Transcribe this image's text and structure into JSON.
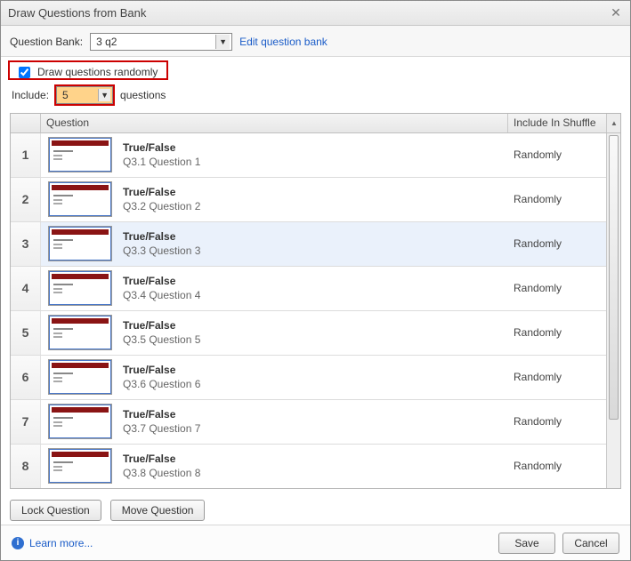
{
  "title": "Draw Questions from Bank",
  "bank": {
    "label": "Question Bank:",
    "selected": "3 q2",
    "edit_link": "Edit question bank"
  },
  "random": {
    "checked": true,
    "label": "Draw questions randomly"
  },
  "include": {
    "label": "Include:",
    "value": "5",
    "suffix": "questions"
  },
  "columns": {
    "question": "Question",
    "include": "Include In Shuffle"
  },
  "include_value": "Randomly",
  "rows": [
    {
      "n": "1",
      "type": "True/False",
      "title": "Q3.1 Question 1",
      "selected": false
    },
    {
      "n": "2",
      "type": "True/False",
      "title": "Q3.2 Question 2",
      "selected": false
    },
    {
      "n": "3",
      "type": "True/False",
      "title": "Q3.3 Question 3",
      "selected": true
    },
    {
      "n": "4",
      "type": "True/False",
      "title": "Q3.4 Question 4",
      "selected": false
    },
    {
      "n": "5",
      "type": "True/False",
      "title": "Q3.5 Question 5",
      "selected": false
    },
    {
      "n": "6",
      "type": "True/False",
      "title": "Q3.6 Question 6",
      "selected": false
    },
    {
      "n": "7",
      "type": "True/False",
      "title": "Q3.7 Question 7",
      "selected": false
    },
    {
      "n": "8",
      "type": "True/False",
      "title": "Q3.8 Question 8",
      "selected": false
    }
  ],
  "buttons": {
    "lock": "Lock Question",
    "move": "Move Question",
    "save": "Save",
    "cancel": "Cancel",
    "learn": "Learn more..."
  }
}
